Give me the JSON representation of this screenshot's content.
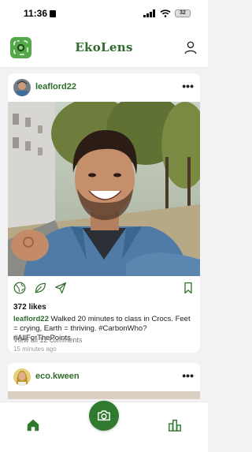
{
  "status_bar": {
    "time": "11:36",
    "battery": "32"
  },
  "header": {
    "title": "EkoLens"
  },
  "posts": [
    {
      "username": "leaflord22",
      "likes": "372 likes",
      "caption_user": "leaflord22",
      "caption_text": " Walked 20 minutes to class in Crocs. Feet = crying, Earth = thriving. #CarbonWho? #AllForThePoints",
      "comments_link": "View all 12 comments",
      "timestamp": "15 minutes ago",
      "more": "•••"
    },
    {
      "username": "eco.kween",
      "more": "•••"
    }
  ],
  "colors": {
    "brand_green": "#2f6b2a",
    "fab_green": "#2f7a2f",
    "logo_green": "#55a84a"
  },
  "icons": [
    "camera-logo-icon",
    "profile-icon",
    "globe-icon",
    "leaf-icon",
    "share-icon",
    "bookmark-icon",
    "home-icon",
    "camera-icon",
    "stats-icon"
  ]
}
